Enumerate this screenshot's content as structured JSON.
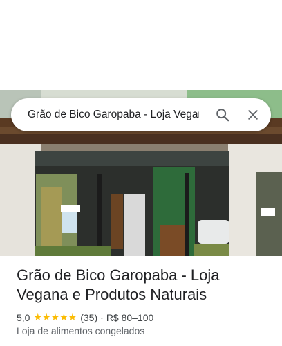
{
  "search": {
    "query": "Grão de Bico Garopaba - Loja Vegana e Produtos Naturais",
    "search_icon": "search-icon",
    "close_icon": "close-icon"
  },
  "photo": {
    "subject": "storefront"
  },
  "place": {
    "name": "Grão de Bico Garopaba - Loja Vegana e Produtos Naturais",
    "rating": "5,0",
    "stars": "★★★★★",
    "reviews": "(35)",
    "separator": "·",
    "price": "R$ 80–100",
    "category": "Loja de alimentos congelados"
  },
  "colors": {
    "star": "#fbbc04",
    "text": "#202124",
    "secondary": "#5f6368"
  }
}
